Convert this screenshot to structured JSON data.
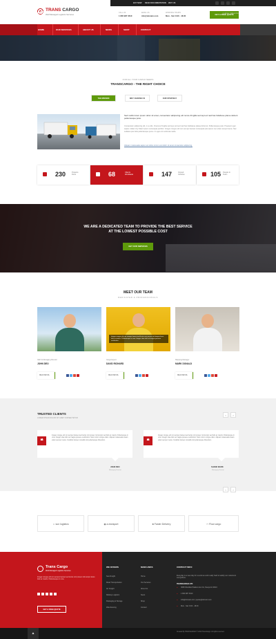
{
  "topbar": {
    "link1": "BUY NOW",
    "link2": "READ DOCUMENTATION",
    "link3": "WHY US"
  },
  "header": {
    "logo_part1": "TRANS",
    "logo_part2": "CARGO",
    "logo_sub": "Well Managed Logistics Services",
    "call_label": "CALL US",
    "call_value": "1 800 987 3610",
    "email_label": "EMAIL US",
    "email_value": "info@domain.com",
    "hours_label": "WORKING HOURS",
    "hours_value": "Mon - Sat: 8.00 - 18.00",
    "quote_btn": "GET A FREE QUOTE"
  },
  "nav": {
    "items": [
      "HOME",
      "OUR SERVICES",
      "ABOUT US",
      "NEWS",
      "SHOP",
      "CONTACT"
    ]
  },
  "hero": {
    "title": "ABOUT US",
    "crumb_home": "Home",
    "crumb_current": "About Us"
  },
  "intro": {
    "pre": "FOR ALL YOUR CARGO NEEDS",
    "title": "TRANSCARGO - THE RIGHT CHOICE",
    "tabs": [
      "THE MISSION",
      "WHY CHOOSE US",
      "OUR STRATEGY"
    ],
    "lead": "Sed mollis lorem ipsum dolor sit amet, consectetur adipiscing elit nonce fringilla sed tept ed nad has hidabuse plame debent pellentesque justo.",
    "para1": "Consectetur adipiscing elit, in a odio. Vivamus fringilla sed ispe ted sed nad has habitasse platea dictumst. Pellentesque justo. Praesent eget sapien. Etiam tiny Mauri ipsum consequat porttitor. Integer congue elit non semper laoreet consequat quis ipsum nec etiam tempor lacus. Nec sodales quis felis pellentesque purus. In eget orci vehicula mattis.",
    "para2": "Aliquam malesuada sapien est tellus rutrum erat dolor sit amet consectetur adipiscing."
  },
  "stats": [
    {
      "num": "230",
      "label1": "Projects",
      "label2": "Done"
    },
    {
      "num": "68",
      "label1": "Clients",
      "label2": "Worldwide"
    },
    {
      "num": "147",
      "label1": "Owned",
      "label2": "Vehicles"
    },
    {
      "num": "105",
      "label1": "People In",
      "label2": "Team"
    }
  ],
  "band": {
    "line1": "WE ARE A DEDICATED TEAM TO PROVIDE THE BEST SERVICE",
    "line2": "AT THE LOWEST POSSIBLE COST",
    "button": "GET OUR SERVICES"
  },
  "team": {
    "title": "MEET OUR TEAM",
    "sub": "DEDICATED & PROFESSIONALS",
    "members": [
      {
        "role": "CEO & Managing Director",
        "name": "JOHN DEO",
        "caption": "",
        "read": "READ DETAIL"
      },
      {
        "role": "Cargo Expert",
        "name": "DAVID RICHARD",
        "caption": "Integer congue elit non semper laoreet sed lectus orci posuer nisl tempor lacus felis ac mauris. Pellentesque in urna. Integer vitae felis vel magna posuere vestibulum.",
        "read": "READ DETAIL"
      },
      {
        "role": "Shipping Manager",
        "name": "MARK DONALD",
        "caption": "",
        "read": "READ DETAIL"
      }
    ]
  },
  "clients": {
    "title": "TRUSTED CLIENTS",
    "sub": "LOREM IPSUM DOLOR SIT AMET CONSECTETUR",
    "quotes": [
      {
        "text": "Integer congue elit non semper laoreet sed lectus orci posuer nisl tempor sed felis ac mauris. Pellentesque in urna. Integer vitae felis vel magna posuere vestibulum. Nam rutrum congue diam. Aliquam malesuada maurs etiam semper metus. Curabitur laoreet convallis nisl pellentesque bibendum.",
        "name": "JOHN DEO",
        "role": "Managing Director"
      },
      {
        "text": "Integer congue elit non semper laoreet sed lectus orci posuer nisl tempor sed felis ac mauris. Pellentesque in urna. Integer vitae felis vel magna posuere vestibulum. Nam rutrum congue diam. Aliquam malesuada maurs etiam semper metus. Curabitur laoreet convallis nisl pellentesque bibendum.",
        "name": "SHANE WARK",
        "role": "Managing Director"
      }
    ],
    "brands": [
      "sun logistics",
      "a-transport",
      "Faster Delivery",
      "Flow cargo"
    ]
  },
  "footer": {
    "logo_part1": "Trans",
    "logo_part2": "Cargo",
    "logo_sub": "Well Managed Logistics Services",
    "about": "Integer congue elit non semper laoreet sed lectus orci posuer nisl tempor lacus felis ac mauris. Pellentesque in urna.",
    "quote_btn": "GET A FREE QUOTE",
    "offers_title": "WE OFFERS",
    "offers": [
      "Sea Freight",
      "Road Transportation",
      "Air Freight",
      "Railway Logistics",
      "Packaging & Storage",
      "Warehousing"
    ],
    "links_title": "MAIN LINKS",
    "links": [
      "Home",
      "Our Services",
      "About Us",
      "News",
      "Shop",
      "Contact"
    ],
    "contact_title": "CONTACT INFO",
    "contact_intro": "Everyday is a new day for us and we work really hard to satisfy our customers everywhere.",
    "company": "TRANSCARGO LTD",
    "address": "3668 Westfield Station Ave CA, Newyork 10010",
    "phone": "1 800 987 3610",
    "email": "info@domain.com  |  quote@domain.com",
    "hours": "Mon - Sat: 8.00 - 18.00",
    "copyright": "Created By TRANSCARGO  © 2019 TransCargo. All rights reserved."
  }
}
